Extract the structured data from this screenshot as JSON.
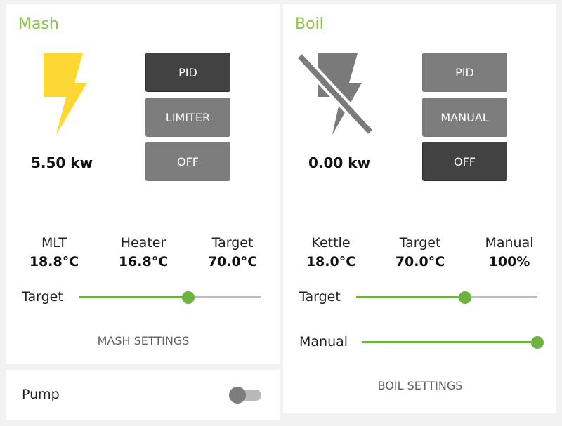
{
  "mash": {
    "title": "Mash",
    "power": "5.50 kw",
    "modes": [
      {
        "label": "PID",
        "active": true
      },
      {
        "label": "LIMITER",
        "active": false
      },
      {
        "label": "OFF",
        "active": false
      }
    ],
    "temps": [
      {
        "label": "MLT",
        "value": "18.8°C"
      },
      {
        "label": "Heater",
        "value": "16.8°C"
      },
      {
        "label": "Target",
        "value": "70.0°C"
      }
    ],
    "target_slider": {
      "label": "Target",
      "fraction": 0.6
    },
    "settings_label": "MASH SETTINGS"
  },
  "pump": {
    "label": "Pump",
    "on": false
  },
  "boil": {
    "title": "Boil",
    "power": "0.00 kw",
    "modes": [
      {
        "label": "PID",
        "active": false
      },
      {
        "label": "MANUAL",
        "active": false
      },
      {
        "label": "OFF",
        "active": true
      }
    ],
    "temps": [
      {
        "label": "Kettle",
        "value": "18.0°C"
      },
      {
        "label": "Target",
        "value": "70.0°C"
      },
      {
        "label": "Manual",
        "value": "100%"
      }
    ],
    "target_slider": {
      "label": "Target",
      "fraction": 0.6
    },
    "manual_slider": {
      "label": "Manual",
      "fraction": 1.0
    },
    "settings_label": "BOIL SETTINGS"
  },
  "colors": {
    "accent": "#8bc34a",
    "slider": "#6cb33f",
    "bolt_on": "#fdd835",
    "bolt_off": "#7a7a7a",
    "button_active": "#424242",
    "button_inactive": "#7d7d7d"
  },
  "icons": {
    "mash_power": "lightning-bolt-icon",
    "boil_power": "lightning-bolt-off-icon"
  }
}
